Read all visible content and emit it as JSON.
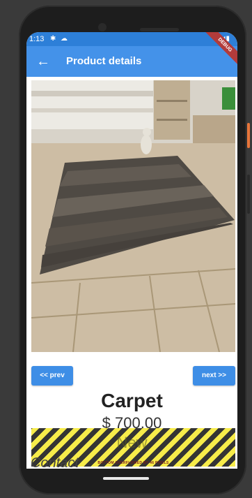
{
  "status_bar": {
    "time": "1:13",
    "settings_icon": "gear-icon",
    "cloud_icon": "cloud-icon",
    "right_icons": "▾◢▮"
  },
  "app_bar": {
    "back_icon": "arrow-left-icon",
    "title": "Product details",
    "debug_banner": "DEBUG"
  },
  "product": {
    "name": "Carpet",
    "price": "$ 700.00",
    "tag": "New"
  },
  "navigation": {
    "prev_label": "<< prev",
    "next_label": "next >>"
  },
  "overflow_warning": "BOTTOM OVERFLOWED BY 46 PIXELS",
  "contact_label": "Contact",
  "colors": {
    "status_bar": "#2d7fd8",
    "app_bar": "#4492e9",
    "button": "#3e8ee6"
  }
}
